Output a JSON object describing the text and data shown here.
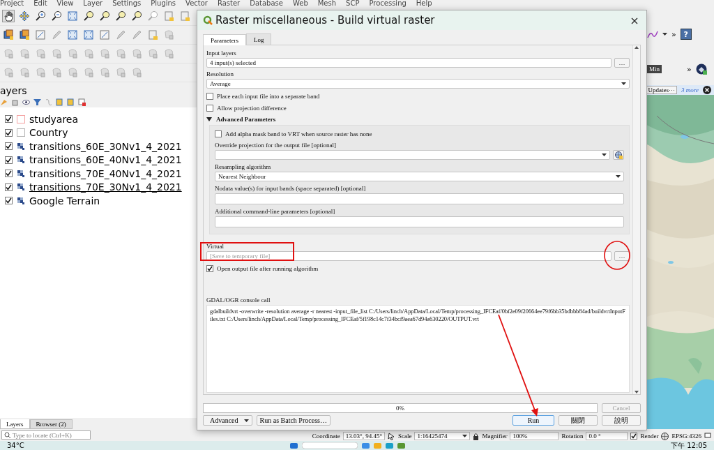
{
  "menu_bar": [
    "Project",
    "Edit",
    "View",
    "Layer",
    "Settings",
    "Plugins",
    "Vector",
    "Raster",
    "Database",
    "Web",
    "Mesh",
    "SCP",
    "Processing",
    "Help"
  ],
  "right_toolbar": {
    "overflow": [
      "»",
      "»"
    ],
    "help": "?",
    "min_button": "Min"
  },
  "message_bar": {
    "button": "Updates···",
    "link": "3 more"
  },
  "layers_panel": {
    "title": "ayers",
    "layers": [
      {
        "name": "studyarea",
        "kind": "polygon",
        "color": "#f4a3a3",
        "checked": true,
        "selected": false
      },
      {
        "name": "Country",
        "kind": "polygon",
        "color": "#b4b4b4",
        "checked": true,
        "selected": false
      },
      {
        "name": "transitions_60E_30Nv1_4_2021",
        "kind": "raster",
        "checked": true,
        "selected": false
      },
      {
        "name": "transitions_60E_40Nv1_4_2021",
        "kind": "raster",
        "checked": true,
        "selected": false
      },
      {
        "name": "transitions_70E_40Nv1_4_2021",
        "kind": "raster",
        "checked": true,
        "selected": false
      },
      {
        "name": "transitions_70E_30Nv1_4_2021",
        "kind": "raster",
        "checked": true,
        "selected": true
      },
      {
        "name": "Google Terrain",
        "kind": "raster",
        "checked": true,
        "selected": false
      }
    ]
  },
  "panel_tabs": [
    {
      "label": "Layers",
      "selected": true
    },
    {
      "label": "Browser (2)",
      "selected": false
    }
  ],
  "locator": {
    "placeholder": "Type to locate (Ctrl+K)"
  },
  "dialog": {
    "title": "Raster miscellaneous - Build virtual raster",
    "tabs": [
      {
        "label": "Parameters",
        "selected": true
      },
      {
        "label": "Log",
        "selected": false
      }
    ],
    "params": [
      {
        "kind": "field_button",
        "label": "Input layers",
        "value": "4 input(s) selected",
        "button": "…"
      },
      {
        "kind": "select",
        "label": "Resolution",
        "value": "Average"
      },
      {
        "kind": "checkbox",
        "label": "Place each input file into a separate band",
        "checked": false
      },
      {
        "kind": "checkbox",
        "label": "Allow projection difference",
        "checked": false
      },
      {
        "kind": "group",
        "label": "Advanced Parameters",
        "expanded": true,
        "children": [
          {
            "kind": "checkbox",
            "label": "Add alpha mask band to VRT when source raster has none",
            "checked": false
          },
          {
            "kind": "select_crs",
            "label": "Override projection for the output file [optional]"
          },
          {
            "kind": "select",
            "label": "Resampling algorithm",
            "value": "Nearest Neighbour"
          },
          {
            "kind": "field",
            "label": "Nodata value(s) for input bands (space separated) [optional]"
          },
          {
            "kind": "field",
            "label": "Additional command-line parameters [optional]"
          }
        ]
      },
      {
        "kind": "output",
        "label": "Virtual",
        "placeholder": "[Save to temporary file]",
        "button": "…"
      },
      {
        "kind": "checkbox",
        "label": "Open output file after running algorithm",
        "checked": true
      }
    ],
    "console": {
      "label": "GDAL/OGR console call",
      "command": "gdalbuildvrt -overwrite -resolution average -r nearest -input_file_list C:/Users/linch/AppData/Local/Temp/processing_IFCEaf/0bf2e09f20664ee79f6bb35bdbbb84ad/buildvrtInputFiles.txt C:/Users/linch/AppData/Local/Temp/processing_IFCEaf/5f198c14c7f34bcf9aea67d94a630220/OUTPUT.vrt"
    },
    "progress": {
      "level": 0,
      "text": "0%"
    },
    "cancel": {
      "label": "Cancel",
      "disabled": true
    },
    "buttons": [
      {
        "label": "Advanced",
        "kind": "menu"
      },
      {
        "label": "Run as Batch Process…",
        "kind": "plain"
      },
      {
        "label": "Run",
        "kind": "default"
      },
      {
        "label": "關閉",
        "kind": "plain"
      },
      {
        "label": "說明",
        "kind": "plain"
      }
    ]
  },
  "status_bar": {
    "coordinate_label": "Coordinate",
    "coordinate": "13.03°, 94.45°",
    "scale_label": "Scale",
    "scale": "1:16425474",
    "magnifier_label": "Magnifier",
    "magnifier": "100%",
    "rotation_label": "Rotation",
    "rotation": "0.0 °",
    "render": {
      "label": "Render",
      "checked": true
    },
    "crs": "EPSG:4326"
  },
  "taskbar": {
    "weather": "34°C",
    "clock": "下午 12:05"
  },
  "annotations": [
    {
      "kind": "rectangle"
    },
    {
      "kind": "circle"
    },
    {
      "kind": "arrow"
    }
  ]
}
